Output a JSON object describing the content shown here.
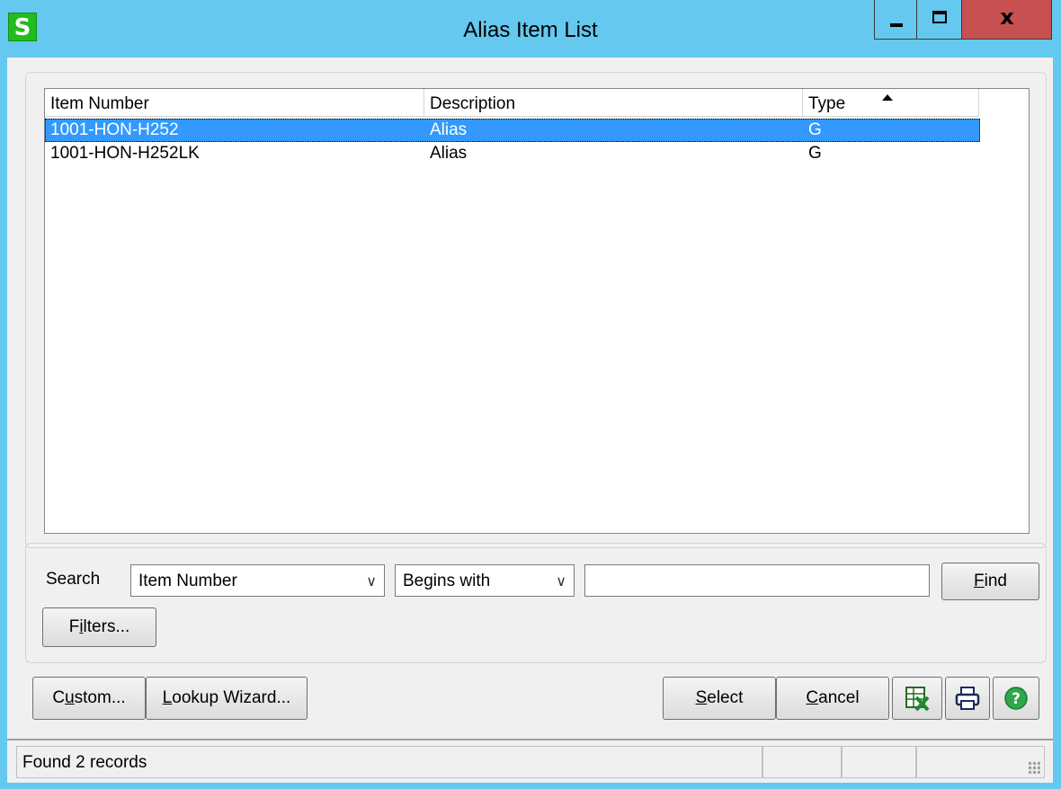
{
  "window": {
    "title": "Alias Item List",
    "app_icon_letter": "S",
    "close_glyph": "x"
  },
  "list": {
    "columns": [
      "Item Number",
      "Description",
      "Type"
    ],
    "rows": [
      {
        "item_number": "1001-HON-H252",
        "description": "Alias",
        "type": "G",
        "selected": true
      },
      {
        "item_number": "1001-HON-H252LK",
        "description": "Alias",
        "type": "G",
        "selected": false
      }
    ]
  },
  "search": {
    "label": "Search",
    "field_value": "Item Number",
    "operator_value": "Begins with",
    "text_value": "",
    "chevron": "∨",
    "find_label_accel": "F",
    "find_label_rest": "ind",
    "filters_label_pre": "F",
    "filters_label_accel": "i",
    "filters_label_rest": "lters..."
  },
  "buttons": {
    "custom_accel": "u",
    "custom_pre": "C",
    "custom_rest": "stom...",
    "lookup_accel": "L",
    "lookup_rest": "ookup Wizard...",
    "select_accel": "S",
    "select_rest": "elect",
    "cancel_accel": "C",
    "cancel_rest": "ancel"
  },
  "status": {
    "message": "Found 2 records"
  },
  "colors": {
    "titlebar": "#65c8ee",
    "close_button": "#c75050",
    "selection": "#3399ff",
    "app_icon": "#1fbd1f"
  }
}
